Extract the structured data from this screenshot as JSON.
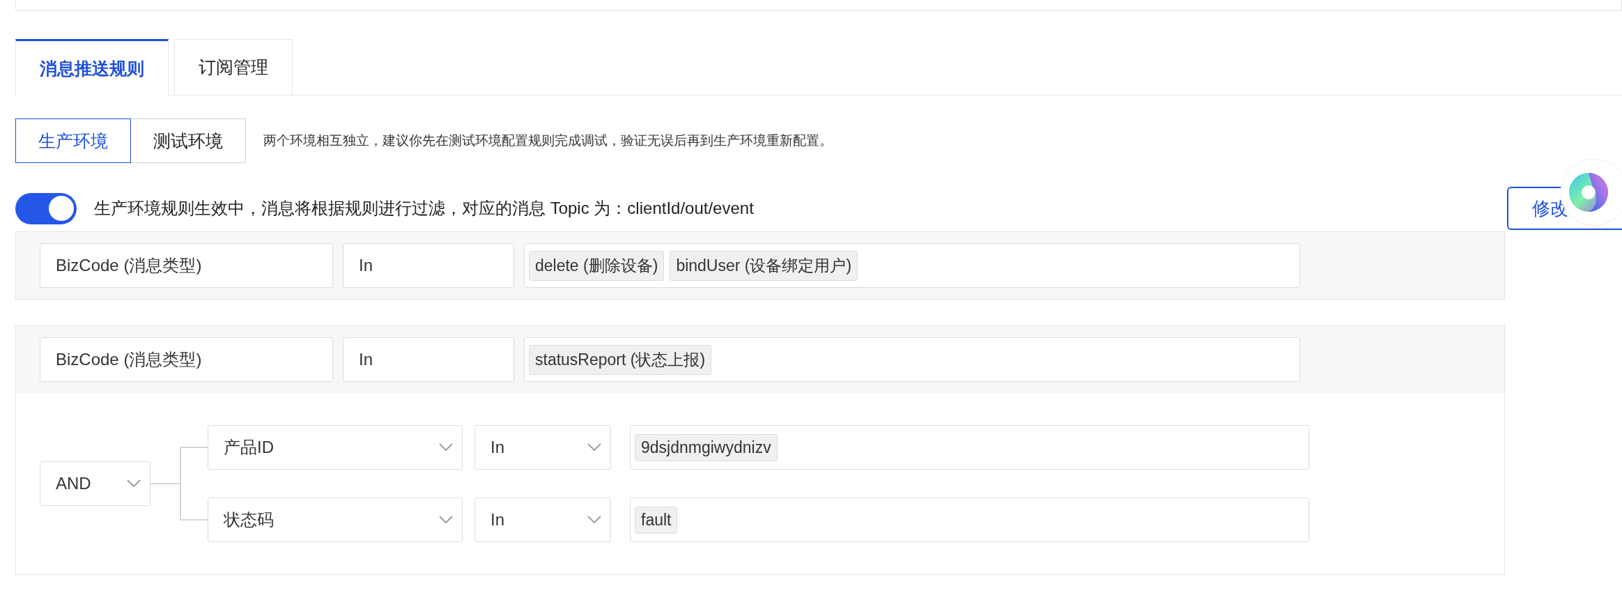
{
  "tabs": [
    {
      "label": "消息推送规则",
      "selected": true
    },
    {
      "label": "订阅管理",
      "selected": false
    }
  ],
  "environments": [
    {
      "label": "生产环境",
      "selected": true
    },
    {
      "label": "测试环境",
      "selected": false
    }
  ],
  "environment_hint": "两个环境相互独立，建议你先在测试环境配置规则完成调试，验证无误后再到生产环境重新配置。",
  "rule_status": {
    "on": true,
    "text": "生产环境规则生效中，消息将根据规则进行过滤，对应的消息 Topic 为：clientId/out/event"
  },
  "edit_button": "修改",
  "rule_groups": [
    {
      "field": "BizCode (消息类型)",
      "operator": "In",
      "values": [
        "delete (删除设备)",
        "bindUser (设备绑定用户)"
      ]
    },
    {
      "field": "BizCode (消息类型)",
      "operator": "In",
      "values": [
        "statusReport (状态上报)"
      ],
      "sub_conditions": {
        "logic": "AND",
        "conditions": [
          {
            "field": "产品ID",
            "operator": "In",
            "values": [
              "9dsjdnmgiwydnizv"
            ]
          },
          {
            "field": "状态码",
            "operator": "In",
            "values": [
              "fault"
            ]
          }
        ]
      }
    }
  ]
}
